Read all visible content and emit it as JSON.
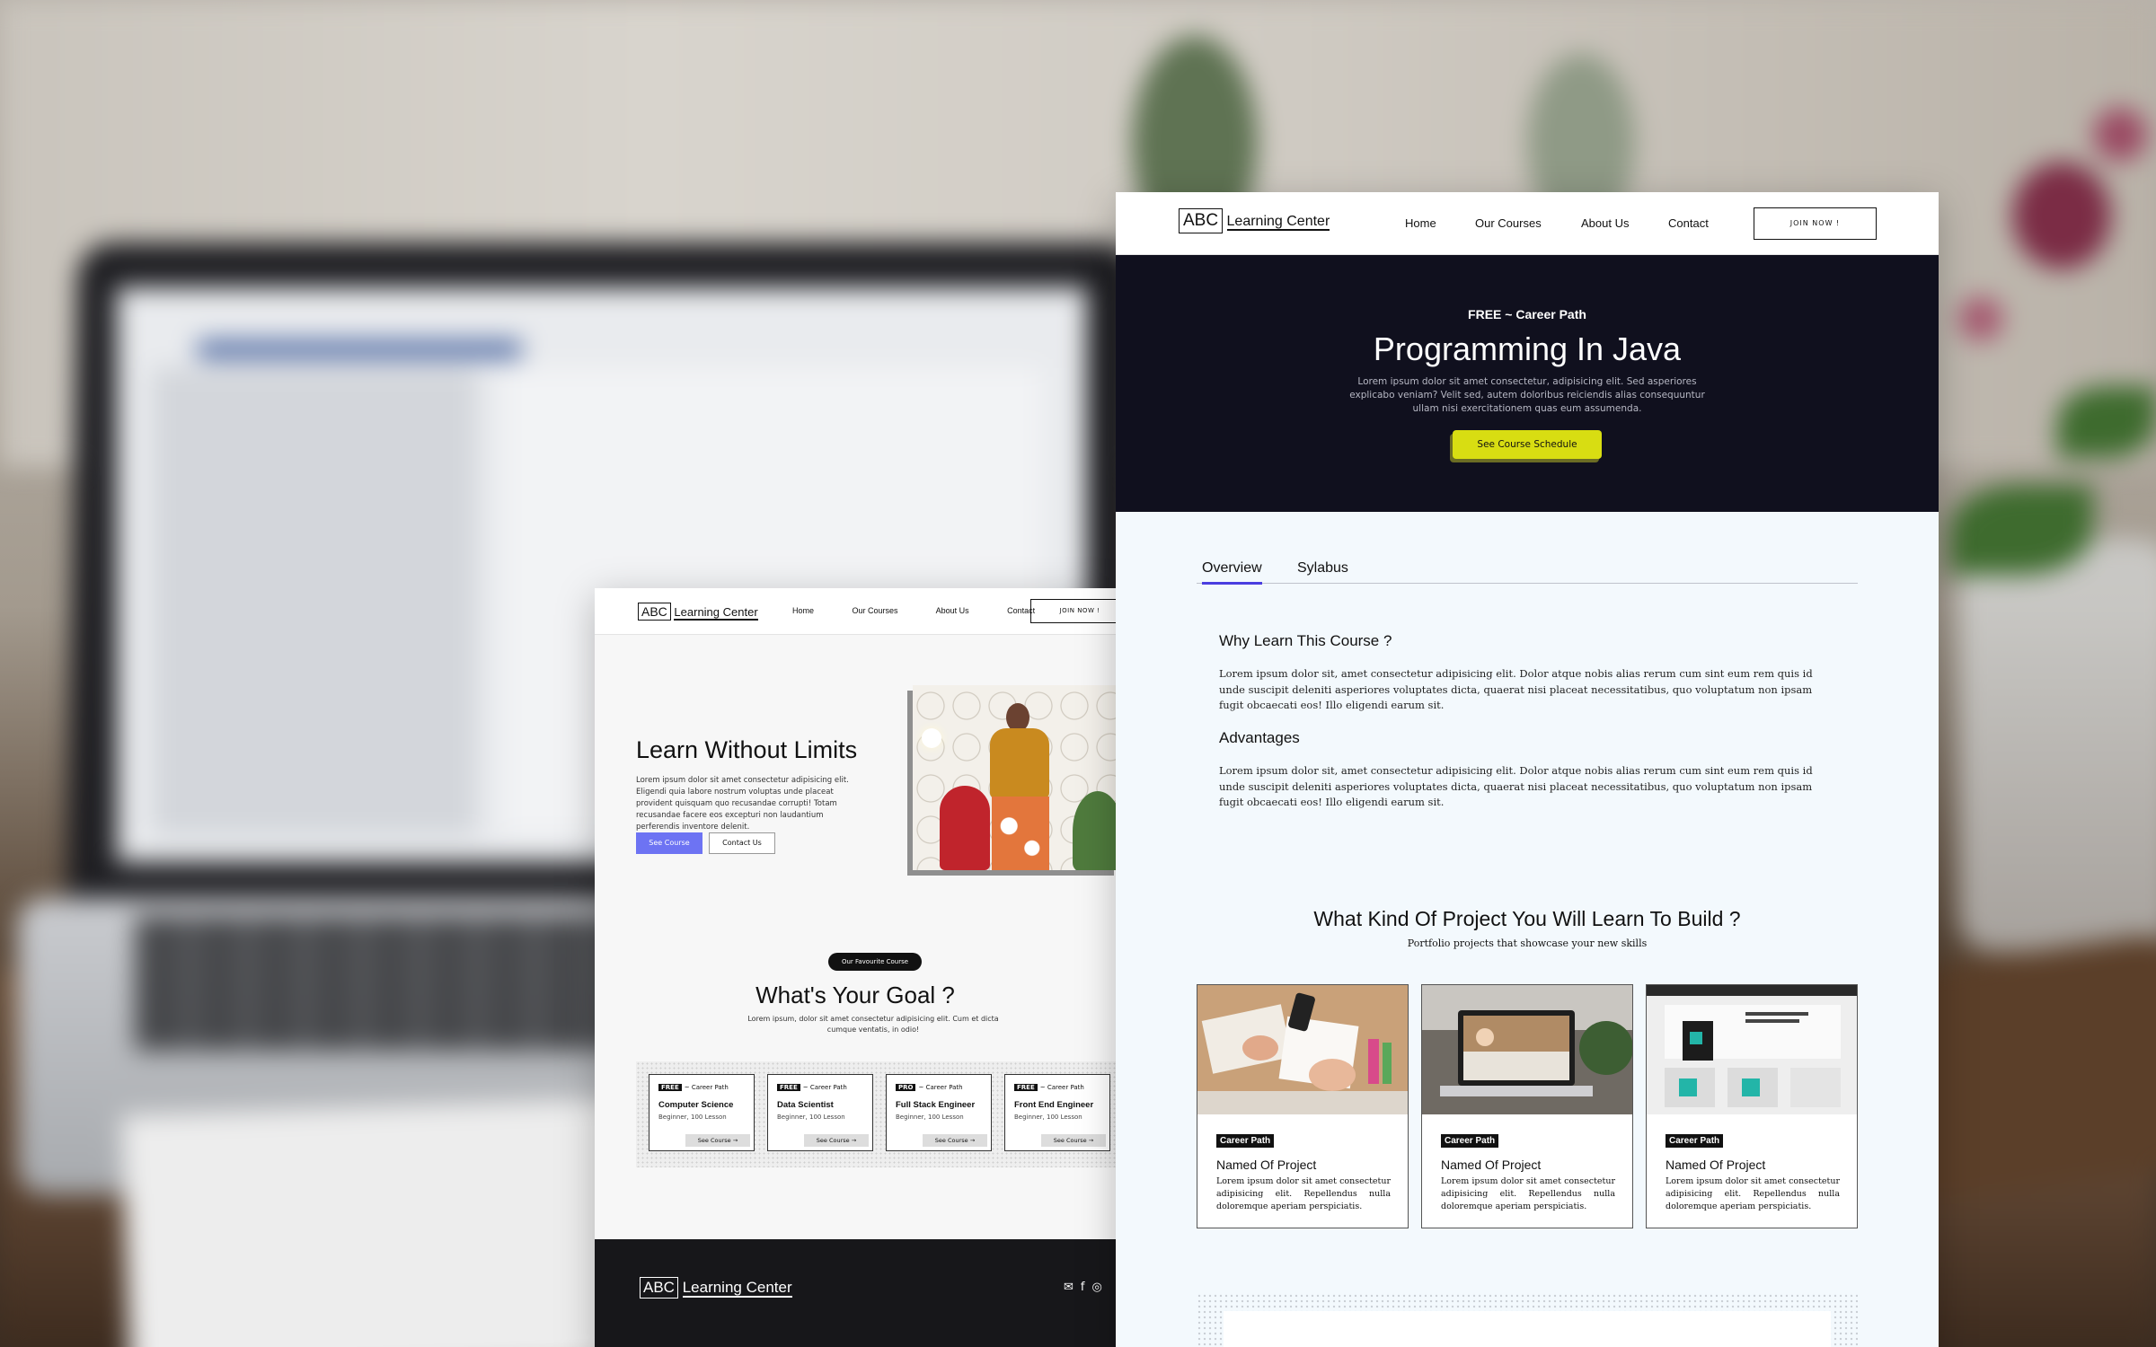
{
  "left_page": {
    "logo": {
      "mark": "ABC",
      "text": "Learning Center"
    },
    "nav": [
      "Home",
      "Our Courses",
      "About Us",
      "Contact"
    ],
    "join_label": "JOIN NOW !",
    "hero": {
      "title": "Learn Without Limits",
      "text": "Lorem ipsum dolor sit amet consectetur adipisicing elit. Eligendi quia labore nostrum voluptas unde placeat provident quisquam quo recusandae corrupti! Totam recusandae facere eos excepturi non laudantium perferendis inventore delenit.",
      "primary_button": "See Course",
      "secondary_button": "Contact Us"
    },
    "goal": {
      "pill": "Our Favourite Course",
      "title": "What's Your Goal ?",
      "text": "Lorem ipsum, dolor sit amet consectetur adipisicing elit. Cum et dicta cumque ventatis, in odio!"
    },
    "courses": [
      {
        "badge": "FREE",
        "path": "~ Career Path",
        "title": "Computer Science",
        "meta": "Beginner, 100 Lesson",
        "button": "See Course →"
      },
      {
        "badge": "FREE",
        "path": "~ Career Path",
        "title": "Data Scientist",
        "meta": "Beginner, 100 Lesson",
        "button": "See Course →"
      },
      {
        "badge": "PRO",
        "path": "~ Career Path",
        "title": "Full Stack Engineer",
        "meta": "Beginner, 100 Lesson",
        "button": "See Course →"
      },
      {
        "badge": "FREE",
        "path": "~ Career Path",
        "title": "Front End Engineer",
        "meta": "Beginner, 100 Lesson",
        "button": "See Course →"
      }
    ],
    "footer": {
      "logo_mark": "ABC",
      "logo_text": "Learning Center",
      "icons": [
        "mail-icon",
        "facebook-icon",
        "instagram-icon"
      ]
    }
  },
  "right_page": {
    "logo": {
      "mark": "ABC",
      "text": "Learning Center"
    },
    "nav": [
      "Home",
      "Our Courses",
      "About Us",
      "Contact"
    ],
    "join_label": "JOIN NOW !",
    "hero": {
      "eyebrow": "FREE ~ Career Path",
      "title": "Programming In Java",
      "text": "Lorem ipsum dolor sit amet consectetur, adipisicing elit. Sed asperiores explicabo veniam? Velit sed, autem doloribus reiciendis alias consequuntur ullam nisi exercitationem quas eum assumenda.",
      "button": "See Course Schedule"
    },
    "tabs": [
      {
        "label": "Overview",
        "active": true
      },
      {
        "label": "Sylabus",
        "active": false
      }
    ],
    "overview": {
      "heading1": "Why Learn This Course ?",
      "para1": "Lorem ipsum dolor sit, amet consectetur adipisicing elit. Dolor atque nobis alias rerum cum sint eum rem quis id unde suscipit deleniti asperiores voluptates dicta, quaerat nisi placeat necessitatibus, quo voluptatum non ipsam fugit obcaecati eos! Illo eligendi earum sit.",
      "heading2": "Advantages",
      "para2": "Lorem ipsum dolor sit, amet consectetur adipisicing elit. Dolor atque nobis alias rerum cum sint eum rem quis id unde suscipit deleniti asperiores voluptates dicta, quaerat nisi placeat necessitatibus, quo voluptatum non ipsam fugit obcaecati eos! Illo eligendi earum sit."
    },
    "projects": {
      "title": "What Kind Of Project You Will Learn To Build ?",
      "subtitle": "Portfolio projects that showcase your new skills",
      "cards": [
        {
          "tag": "Career Path",
          "title": "Named Of Project",
          "text": "Lorem ipsum dolor sit amet consectetur adipisicing elit. Repellendus nulla doloremque aperiam perspiciatis."
        },
        {
          "tag": "Career Path",
          "title": "Named Of Project",
          "text": "Lorem ipsum dolor sit amet consectetur adipisicing elit. Repellendus nulla doloremque aperiam perspiciatis."
        },
        {
          "tag": "Career Path",
          "title": "Named Of Project",
          "text": "Lorem ipsum dolor sit amet consectetur adipisicing elit. Repellendus nulla doloremque aperiam perspiciatis."
        }
      ]
    }
  },
  "colors": {
    "hero_dark": "#10101e",
    "accent_yellow": "#d8dd12",
    "accent_purple": "#6d73f3",
    "tab_underline": "#4a3ee0"
  }
}
